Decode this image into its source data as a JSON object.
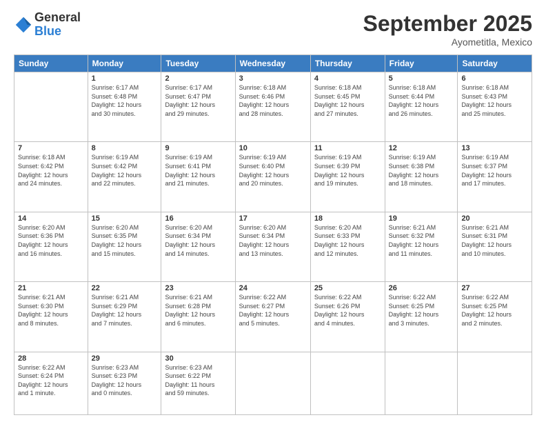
{
  "logo": {
    "general": "General",
    "blue": "Blue"
  },
  "header": {
    "month": "September 2025",
    "location": "Ayometitla, Mexico"
  },
  "weekdays": [
    "Sunday",
    "Monday",
    "Tuesday",
    "Wednesday",
    "Thursday",
    "Friday",
    "Saturday"
  ],
  "weeks": [
    [
      {
        "day": "",
        "info": ""
      },
      {
        "day": "1",
        "info": "Sunrise: 6:17 AM\nSunset: 6:48 PM\nDaylight: 12 hours\nand 30 minutes."
      },
      {
        "day": "2",
        "info": "Sunrise: 6:17 AM\nSunset: 6:47 PM\nDaylight: 12 hours\nand 29 minutes."
      },
      {
        "day": "3",
        "info": "Sunrise: 6:18 AM\nSunset: 6:46 PM\nDaylight: 12 hours\nand 28 minutes."
      },
      {
        "day": "4",
        "info": "Sunrise: 6:18 AM\nSunset: 6:45 PM\nDaylight: 12 hours\nand 27 minutes."
      },
      {
        "day": "5",
        "info": "Sunrise: 6:18 AM\nSunset: 6:44 PM\nDaylight: 12 hours\nand 26 minutes."
      },
      {
        "day": "6",
        "info": "Sunrise: 6:18 AM\nSunset: 6:43 PM\nDaylight: 12 hours\nand 25 minutes."
      }
    ],
    [
      {
        "day": "7",
        "info": "Sunrise: 6:18 AM\nSunset: 6:42 PM\nDaylight: 12 hours\nand 24 minutes."
      },
      {
        "day": "8",
        "info": "Sunrise: 6:19 AM\nSunset: 6:42 PM\nDaylight: 12 hours\nand 22 minutes."
      },
      {
        "day": "9",
        "info": "Sunrise: 6:19 AM\nSunset: 6:41 PM\nDaylight: 12 hours\nand 21 minutes."
      },
      {
        "day": "10",
        "info": "Sunrise: 6:19 AM\nSunset: 6:40 PM\nDaylight: 12 hours\nand 20 minutes."
      },
      {
        "day": "11",
        "info": "Sunrise: 6:19 AM\nSunset: 6:39 PM\nDaylight: 12 hours\nand 19 minutes."
      },
      {
        "day": "12",
        "info": "Sunrise: 6:19 AM\nSunset: 6:38 PM\nDaylight: 12 hours\nand 18 minutes."
      },
      {
        "day": "13",
        "info": "Sunrise: 6:19 AM\nSunset: 6:37 PM\nDaylight: 12 hours\nand 17 minutes."
      }
    ],
    [
      {
        "day": "14",
        "info": "Sunrise: 6:20 AM\nSunset: 6:36 PM\nDaylight: 12 hours\nand 16 minutes."
      },
      {
        "day": "15",
        "info": "Sunrise: 6:20 AM\nSunset: 6:35 PM\nDaylight: 12 hours\nand 15 minutes."
      },
      {
        "day": "16",
        "info": "Sunrise: 6:20 AM\nSunset: 6:34 PM\nDaylight: 12 hours\nand 14 minutes."
      },
      {
        "day": "17",
        "info": "Sunrise: 6:20 AM\nSunset: 6:34 PM\nDaylight: 12 hours\nand 13 minutes."
      },
      {
        "day": "18",
        "info": "Sunrise: 6:20 AM\nSunset: 6:33 PM\nDaylight: 12 hours\nand 12 minutes."
      },
      {
        "day": "19",
        "info": "Sunrise: 6:21 AM\nSunset: 6:32 PM\nDaylight: 12 hours\nand 11 minutes."
      },
      {
        "day": "20",
        "info": "Sunrise: 6:21 AM\nSunset: 6:31 PM\nDaylight: 12 hours\nand 10 minutes."
      }
    ],
    [
      {
        "day": "21",
        "info": "Sunrise: 6:21 AM\nSunset: 6:30 PM\nDaylight: 12 hours\nand 8 minutes."
      },
      {
        "day": "22",
        "info": "Sunrise: 6:21 AM\nSunset: 6:29 PM\nDaylight: 12 hours\nand 7 minutes."
      },
      {
        "day": "23",
        "info": "Sunrise: 6:21 AM\nSunset: 6:28 PM\nDaylight: 12 hours\nand 6 minutes."
      },
      {
        "day": "24",
        "info": "Sunrise: 6:22 AM\nSunset: 6:27 PM\nDaylight: 12 hours\nand 5 minutes."
      },
      {
        "day": "25",
        "info": "Sunrise: 6:22 AM\nSunset: 6:26 PM\nDaylight: 12 hours\nand 4 minutes."
      },
      {
        "day": "26",
        "info": "Sunrise: 6:22 AM\nSunset: 6:25 PM\nDaylight: 12 hours\nand 3 minutes."
      },
      {
        "day": "27",
        "info": "Sunrise: 6:22 AM\nSunset: 6:25 PM\nDaylight: 12 hours\nand 2 minutes."
      }
    ],
    [
      {
        "day": "28",
        "info": "Sunrise: 6:22 AM\nSunset: 6:24 PM\nDaylight: 12 hours\nand 1 minute."
      },
      {
        "day": "29",
        "info": "Sunrise: 6:23 AM\nSunset: 6:23 PM\nDaylight: 12 hours\nand 0 minutes."
      },
      {
        "day": "30",
        "info": "Sunrise: 6:23 AM\nSunset: 6:22 PM\nDaylight: 11 hours\nand 59 minutes."
      },
      {
        "day": "",
        "info": ""
      },
      {
        "day": "",
        "info": ""
      },
      {
        "day": "",
        "info": ""
      },
      {
        "day": "",
        "info": ""
      }
    ]
  ]
}
